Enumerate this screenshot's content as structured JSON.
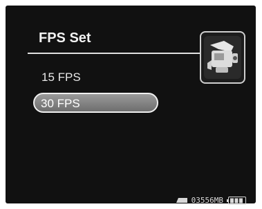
{
  "menu": {
    "title": "FPS Set",
    "options": [
      {
        "label": "15 FPS",
        "selected": false
      },
      {
        "label": "30 FPS",
        "selected": true
      }
    ]
  },
  "header": {
    "mode_icon": "camcorder-icon"
  },
  "status_bar": {
    "storage_icon": "memory-card-icon",
    "storage_text": "03556MB",
    "battery_icon": "battery-icon",
    "battery_level": 1.0
  },
  "colors": {
    "background": "#111111",
    "text": "#f2f2f2",
    "selection_fill": "#8a8a8a",
    "selection_border": "#f0f0f0"
  }
}
